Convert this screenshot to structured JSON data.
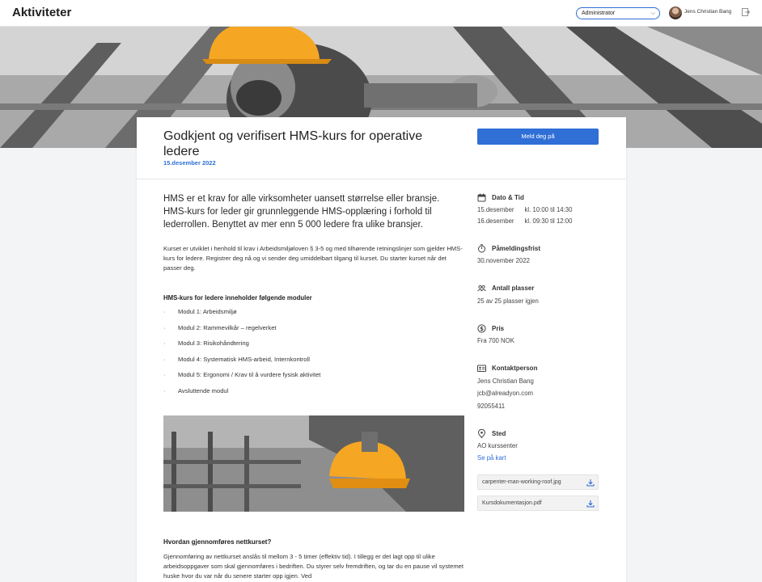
{
  "app": {
    "title": "Aktiviteter"
  },
  "header": {
    "role": "Administrator",
    "user_name": "Jens Christian Bang"
  },
  "course": {
    "title": "Godkjent og verifisert HMS-kurs for operative ledere",
    "date": "15.desember 2022",
    "signup_label": "Meld deg på",
    "lead": "HMS er et krav for alle virksomheter uansett størrelse eller bransje. HMS-kurs for leder gir grunnleggende HMS-opplæring i forhold til lederrollen. Benyttet av mer enn 5 000 ledere fra ulike bransjer.",
    "intro": "Kurset er utviklet i henhold til krav i Arbeidsmiljøloven § 3-5 og med tilhørende retningslinjer som gjelder HMS-kurs for ledere. Registrer deg nå og vi sender deg umiddelbart tilgang til kurset. Du starter kurset når det passer deg.",
    "modules_title": "HMS-kurs for ledere inneholder følgende moduler",
    "modules": [
      "Modul 1: Arbeidsmiljø",
      "Modul 2: Rammevilkår – regelverket",
      "Modul 3: Risikohåndtering",
      "Modul 4: Systematisk HMS-arbeid, Internkontroll",
      "Modul 5: Ergonomi / Krav til å vurdere fysisk aktivitet",
      "Avsluttende modul"
    ],
    "question_title": "Hvordan gjennomføres nettkurset?",
    "question_text": "Gjennomføring av nettkurset anslås til mellom 3 - 5 timer (effektiv tid). I tillegg er det lagt opp til ulike arbeidsoppgaver som skal gjennomføres i bedriften. Du styrer selv fremdriften, og tar du en pause vil systemet huske hvor du var når du senere starter opp igjen. Ved"
  },
  "sidebar": {
    "date_time": {
      "label": "Dato & Tid",
      "rows": [
        {
          "date": "15.desember",
          "time": "kl. 10:00 til 14:30"
        },
        {
          "date": "16.desember",
          "time": "kl. 09:30 til 12:00"
        }
      ]
    },
    "deadline": {
      "label": "Påmeldingsfrist",
      "value": "30.november 2022"
    },
    "seats": {
      "label": "Antall plasser",
      "value": "25 av 25 plasser igjen"
    },
    "price": {
      "label": "Pris",
      "value": "Fra 700 NOK"
    },
    "contact": {
      "label": "Kontaktperson",
      "name": "Jens Christian Bang",
      "email": "jcb@alreadyon.com",
      "phone": "92055411"
    },
    "location": {
      "label": "Sted",
      "value": "AO kurssenter",
      "map_link": "Se på kart"
    },
    "files": [
      "carpenter-man-working-roof.jpg",
      "Kursdokumentasjon.pdf"
    ]
  },
  "colors": {
    "accent": "#2f6fd6",
    "helmet": "#f5a623"
  }
}
